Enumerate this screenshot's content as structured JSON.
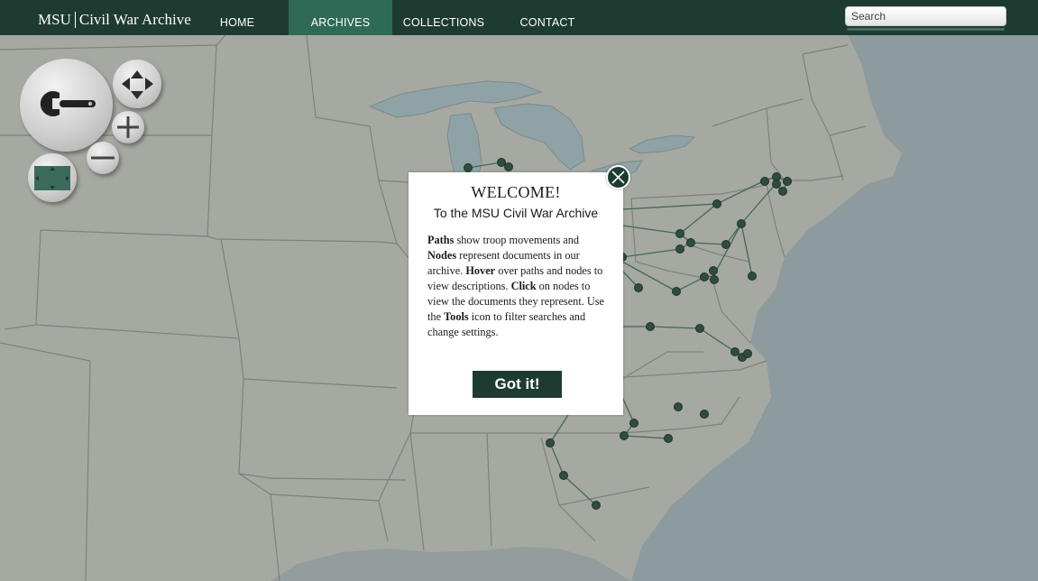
{
  "header": {
    "logo_left": "MSU",
    "logo_right": "Civil War Archive",
    "nav": [
      {
        "label": "HOME",
        "active": false
      },
      {
        "label": "ARCHIVES",
        "active": true
      },
      {
        "label": "COLLECTIONS",
        "active": false
      },
      {
        "label": "CONTACT",
        "active": false
      }
    ],
    "search_placeholder": "Search"
  },
  "tools": {
    "main_icon": "wrench-icon",
    "pan_icon": "pan-arrows-icon",
    "zoom_in_icon": "plus-icon",
    "zoom_out_icon": "minus-icon",
    "extent_icon": "full-extent-icon"
  },
  "modal": {
    "title": "WELCOME!",
    "subtitle": "To the MSU Civil War Archive",
    "body": [
      {
        "text": "Paths",
        "bold": true
      },
      {
        "text": " show troop movements and ",
        "bold": false
      },
      {
        "text": "Nodes",
        "bold": true
      },
      {
        "text": " represent documents in our archive. ",
        "bold": false
      },
      {
        "text": "Hover",
        "bold": true
      },
      {
        "text": " over paths and nodes to view descriptions. ",
        "bold": false
      },
      {
        "text": "Click",
        "bold": true
      },
      {
        "text": " on nodes to view the documents they represent. Use the ",
        "bold": false
      },
      {
        "text": "Tools",
        "bold": true
      },
      {
        "text": " icon to filter searches and change settings.",
        "bold": false
      }
    ],
    "button": "Got it!",
    "close_icon": "close-icon"
  },
  "colors": {
    "header_bg": "#1e3b32",
    "nav_active_bg": "#2f6a56",
    "land": "#a6a8a2",
    "water": "#8d9b9e",
    "node": "#2f4c3f",
    "path": "#3f6a56"
  }
}
